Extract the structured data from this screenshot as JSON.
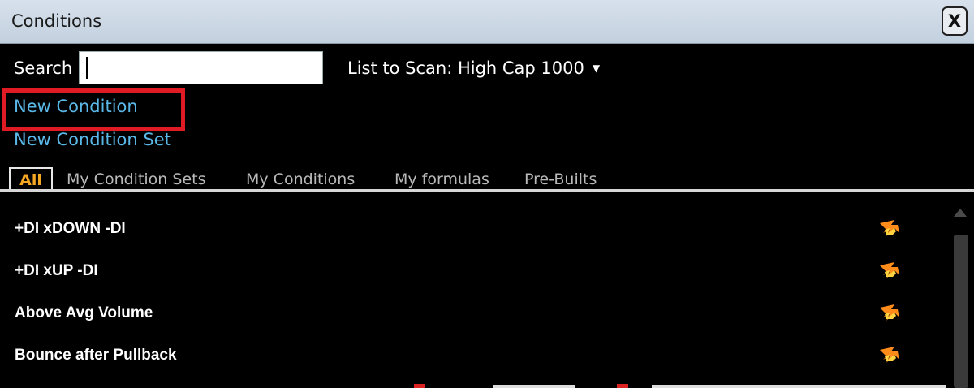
{
  "window": {
    "title": "Conditions",
    "close_label": "X"
  },
  "search": {
    "label": "Search",
    "value": "",
    "placeholder": ""
  },
  "scan": {
    "label": "List to Scan: High Cap 1000"
  },
  "actions": {
    "new_condition": "New Condition",
    "new_condition_set": "New Condition Set"
  },
  "tabs": [
    {
      "label": "All",
      "active": true
    },
    {
      "label": "My Condition Sets",
      "active": false
    },
    {
      "label": "My Conditions",
      "active": false
    },
    {
      "label": "My formulas",
      "active": false
    },
    {
      "label": "Pre-Builts",
      "active": false
    }
  ],
  "conditions": [
    {
      "label": "+DI xDOWN -DI",
      "icon": "fire-icon"
    },
    {
      "label": "+DI xUP -DI",
      "icon": "fire-icon"
    },
    {
      "label": "Above Avg Volume",
      "icon": "fire-icon"
    },
    {
      "label": "Bounce after Pullback",
      "icon": "fire-icon"
    }
  ],
  "colors": {
    "link": "#5ab8e8",
    "active_tab": "#f5a623",
    "highlight": "#e01b24",
    "flame": "#ff8c1a"
  }
}
